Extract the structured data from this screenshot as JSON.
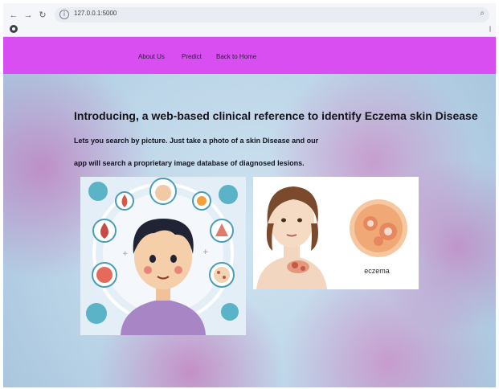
{
  "browser": {
    "url": "127.0.0.1:5000",
    "back_icon": "back-arrow-icon",
    "forward_icon": "forward-arrow-icon",
    "reload_icon": "reload-icon",
    "zoom_icon": "zoom-icon"
  },
  "nav": {
    "items": [
      "About Us",
      "Predict",
      "Back to Home"
    ],
    "color": "#d84ef0"
  },
  "hero": {
    "heading": "Introducing, a web-based clinical reference to identify Eczema skin Disease",
    "line1": "Lets you search by picture. Just take a photo of a skin Disease and our",
    "line2": "app will search a proprietary image database of diagnosed lesions."
  },
  "images": {
    "illustration_label": "eczema"
  }
}
